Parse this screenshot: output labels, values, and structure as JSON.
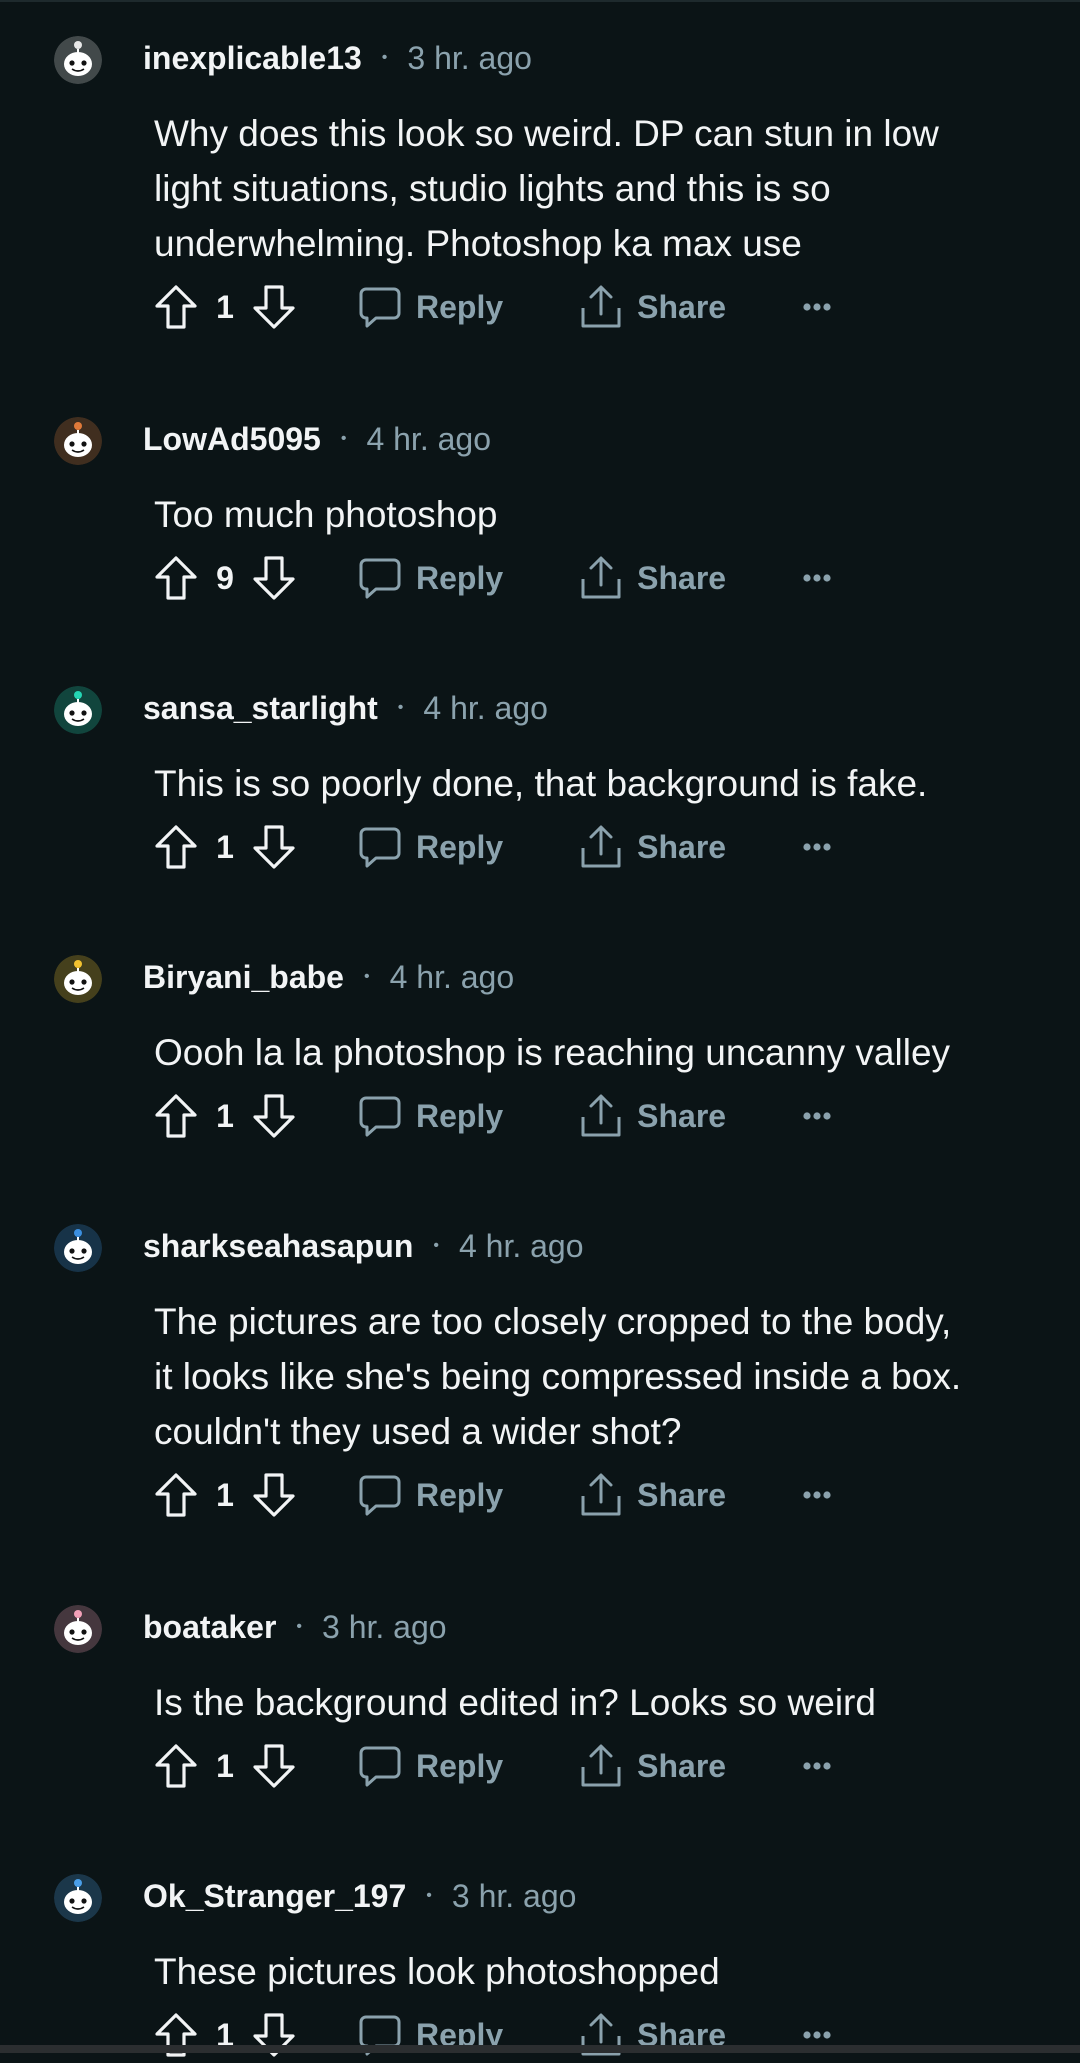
{
  "actions": {
    "reply_label": "Reply",
    "share_label": "Share"
  },
  "comments": [
    {
      "username": "inexplicable13",
      "time": "3 hr. ago",
      "text": [
        "Why does this look so weird. DP can stun in low",
        "light situations, studio lights and this is so",
        "underwhelming. Photoshop ka max use"
      ],
      "votes": "1",
      "avatar_color": "#e8e8e8"
    },
    {
      "username": "LowAd5095",
      "time": "4 hr. ago",
      "text": [
        "Too much photoshop"
      ],
      "votes": "9",
      "avatar_color": "#e07a3a"
    },
    {
      "username": "sansa_starlight",
      "time": "4 hr. ago",
      "text": [
        "This is so poorly done, that background is fake."
      ],
      "votes": "1",
      "avatar_color": "#24d6b4"
    },
    {
      "username": "Biryani_babe",
      "time": "4 hr. ago",
      "text": [
        "Oooh la la photoshop is reaching uncanny valley"
      ],
      "votes": "1",
      "avatar_color": "#f2c230"
    },
    {
      "username": "sharkseahasapun",
      "time": "4 hr. ago",
      "text": [
        "The pictures are too closely cropped to the body,",
        "it looks like she's being compressed inside a box.",
        "couldn't they used a wider shot?"
      ],
      "votes": "1",
      "avatar_color": "#3b8fe0"
    },
    {
      "username": "boataker",
      "time": "3 hr. ago",
      "text": [
        "Is the background edited in? Looks so weird"
      ],
      "votes": "1",
      "avatar_color": "#f2a0b8"
    },
    {
      "username": "Ok_Stranger_197",
      "time": "3 hr. ago",
      "text": [
        "These pictures look photoshopped"
      ],
      "votes": "1",
      "avatar_color": "#4a9ee8"
    }
  ],
  "colors": {
    "background": "#0b1416",
    "text": "#f2f4f5",
    "muted": "#8ba2ad"
  },
  "icons": [
    "upvote-icon",
    "downvote-icon",
    "comment-bubble-icon",
    "share-icon",
    "more-options-icon"
  ]
}
